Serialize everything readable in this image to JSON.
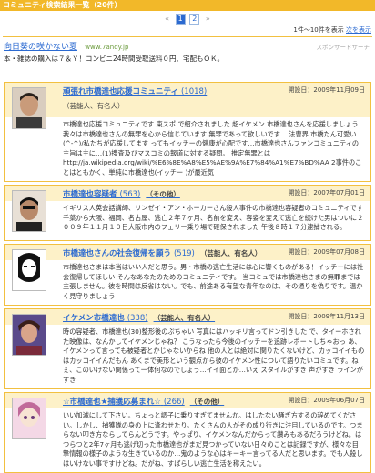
{
  "window": {
    "title": "コミュニティ検索結果一覧（20件）"
  },
  "pager": {
    "prev": "«",
    "next": "»",
    "pages": [
      "1",
      "2"
    ],
    "current": "1"
  },
  "results": {
    "count_text": "1件～10件を表示",
    "next_link": "次を表示"
  },
  "ad": {
    "title": "向日葵の咲かない夏",
    "url": "www.7andy.jp",
    "sponsor_label": "スポンサードサーチ",
    "description": "本・雑誌の購入は７＆Ｙ！コンビニ24時間受取送料０円、宅配もＯＫ。"
  },
  "communities": [
    {
      "title": "頑張れ市橋達也応援コミュニティ",
      "count": "(1018)",
      "date": "開設日：2009年11月09日",
      "category": "（芸能人、有名人）",
      "description": "市橋達也応援コミュニティです 東スポ で紹介されました 超イケメン 市橋達也さんを応援しましょう 我々は市橋達也さんの無罪を心から信じています 無罪であって欲しいです …法曹界 市橋たん可愛い(^-^)/私たちが応援してます ってもイッチーの健康が心配です…市橋達也さんファンコミュニティの主旨は主に…(1)捜査及びマスコミの報道に対する疑問。 推定無罪とは http://ja.wikipedia.org/wiki/%E6%8E%A8%E5%AE%9A%E7%84%A1%E7%BD%AA 2事件のことはともかく、単純に市橋達也(イッチー )が最近気"
    },
    {
      "title": "市橋達也容疑者",
      "count": "(563)",
      "date": "開設日：2007年07月01日",
      "category": "（その他）",
      "description": "イギリス人英会話講師、リンゼイ・アン・ホーカーさん殺人事件の市橋達也容疑者のコミュニティです 千葉から大阪、福岡、名古屋、逃亡２年７ヶ月、名前を変え、容姿を変えて逃亡を続けた男はついに２００９年１１月１０日大阪市内のフェリー乗り場で確保されました 午後８時１７分逮捕される。"
    },
    {
      "title": "市橋達也さんの社会復帰を願う",
      "count": "(519)",
      "date": "開設日：2009年07月08日",
      "category": "（芸能人、有名人）",
      "description": "市橋達也さまは本当はいい人だと思う。男・市橋の逃亡生活には心に響くものがある！イッチーには社会復帰してほしい そんなあなたのためのコミュニティです。 当コミュでは市橋達也さまの無罪までは主張しません。彼を時間は反省はない。でも、前途ある有望な青年なのは、その通りを偽りです。温かく見守りましょう"
    },
    {
      "title": "イケメン市橋達也",
      "count": "(338)",
      "date": "開設日：2009年11月13日",
      "category": "（芸能人、有名人）",
      "description": "時の容疑者、市橋達也(30)整形後のぷちゃい 写真にはハッキリ言ってドン引きした で、タイーホされた映像は、なんかしてイケメンじゃね？ こうなったら今後のイッチーを追跡レポートしちゃおっ あ、イケメンって言っても被疑者とかじゃないからね 他の人とは絶対に関りたくないけど、カッコイイものはカッコイイんだもん あくまで美形という観点から彼のイケメン性について語りたいコミュです。ねぇ、このいけない関係って一体何なのでしょう…イイ面とか…いえ スタイルがすき 声がすき ラインがすき"
    },
    {
      "title": "☆市橋達也★捕獲応募まれ☆",
      "count": "(266)",
      "date": "開設日：2009年06月07日",
      "category": "（その他）",
      "description": "いい加減にして下さい。ちょっと調子に乗りすぎてませんか。はしたない騒ぎ方するの辞めてください。しかし、捕獲隊の身の上に逢わせたり。たくさんの人がその成り行きに注目しているのです。つまらない叩き方ならしてらんどうです。やっぱり、イケメンなんだからって讃みもあるだろうけどね。はつらつと2年7ヶ月も逃げ切った市橋達也がまだ見つかっていない日々のことは記録ですが、様々な目撃情報の様子のような生きているのか…鬼のような心はキーキー言ってる人だと思います。でも人殺しはいけない事ですけどね。だがね、すばらしい逃亡生活を称えたい。"
    }
  ],
  "colors": {
    "accent": "#f2b829",
    "link": "#2b6ad1",
    "card_header": "#fdf1c8",
    "border": "#f2c040"
  }
}
